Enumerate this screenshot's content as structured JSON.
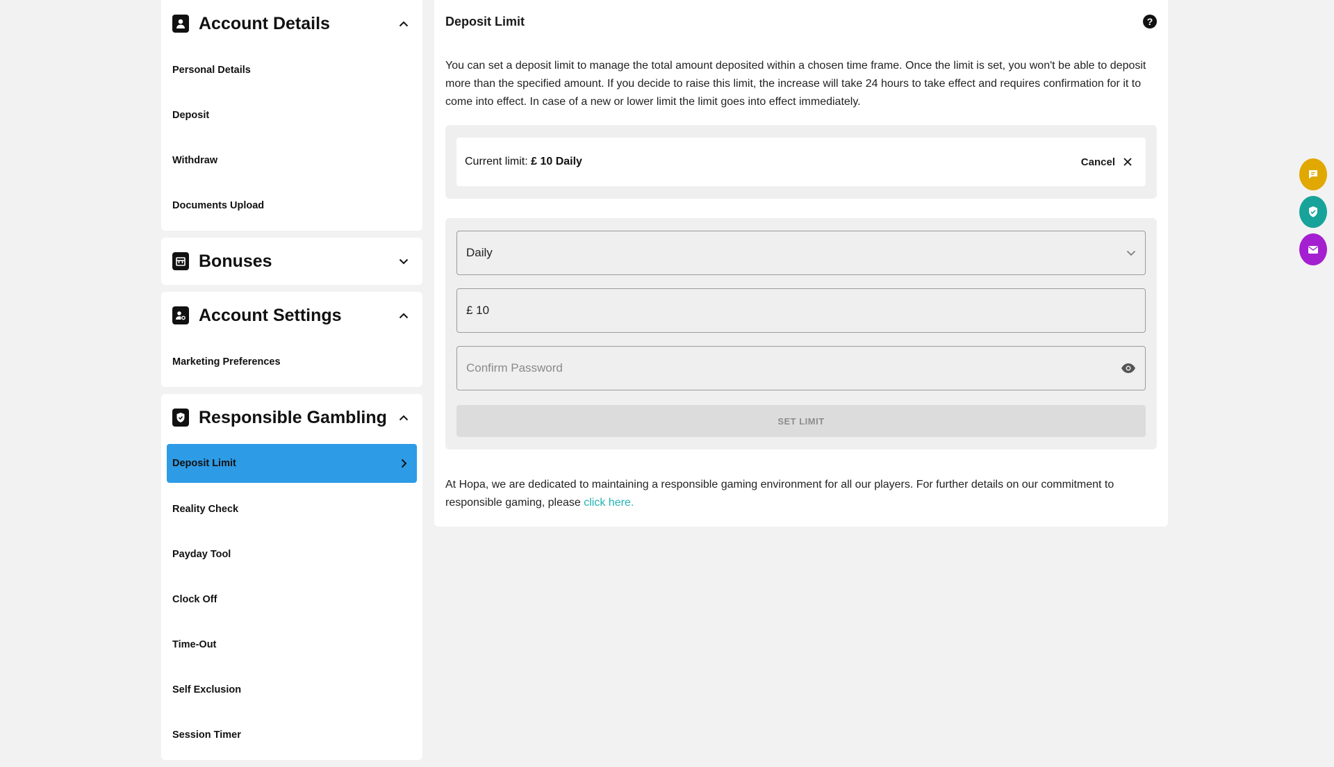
{
  "sidebar": {
    "account_details": {
      "title": "Account Details",
      "items": [
        "Personal Details",
        "Deposit",
        "Withdraw",
        "Documents Upload"
      ]
    },
    "bonuses": {
      "title": "Bonuses"
    },
    "account_settings": {
      "title": "Account Settings",
      "items": [
        "Marketing Preferences"
      ]
    },
    "responsible_gambling": {
      "title": "Responsible Gambling",
      "active_item": "Deposit Limit",
      "items": [
        "Reality Check",
        "Payday Tool",
        "Clock Off",
        "Time-Out",
        "Self Exclusion",
        "Session Timer"
      ]
    }
  },
  "main": {
    "title": "Deposit Limit",
    "description": "You can set a deposit limit to manage the total amount deposited within a chosen time frame. Once the limit is set, you won't be able to deposit more than the specified amount. If you decide to raise this limit, the increase will take 24 hours to take effect and requires confirmation for it to come into effect. In case of a new or lower limit the limit goes into effect immediately.",
    "current_limit": {
      "label": "Current limit: ",
      "value": "£ 10 Daily"
    },
    "cancel_label": "Cancel",
    "period_select": {
      "value": "Daily"
    },
    "amount_field": {
      "value": "£ 10"
    },
    "password_field": {
      "placeholder": "Confirm Password"
    },
    "submit_label": "SET LIMIT",
    "footer_text": "At Hopa, we are dedicated to maintaining a responsible gaming environment for all our players. For further details on our commitment to responsible gaming, please ",
    "footer_link": "click here."
  },
  "floating": {
    "colors": {
      "chat": "#e0a800",
      "shield": "#17a39a",
      "mail": "#a41fd0"
    }
  },
  "colors": {
    "active_nav": "#2e9be6",
    "link": "#21b3b0"
  }
}
